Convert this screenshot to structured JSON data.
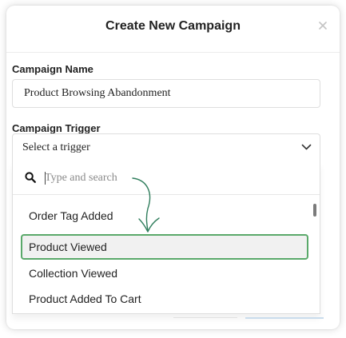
{
  "modal": {
    "title": "Create New Campaign",
    "close_icon": "close-icon"
  },
  "campaign_name": {
    "label": "Campaign Name",
    "value": "Product Browsing Abandonment"
  },
  "campaign_trigger": {
    "label": "Campaign Trigger",
    "selected_text": "Select a trigger",
    "chevron_icon": "chevron-down-icon"
  },
  "dropdown": {
    "search_placeholder": "Type and search",
    "search_icon": "search-icon",
    "options": [
      {
        "label": "Order Tag Added"
      },
      {
        "label": "Product Viewed",
        "highlighted": true
      },
      {
        "label": "Collection Viewed"
      },
      {
        "label": "Product Added To Cart"
      }
    ]
  },
  "colors": {
    "highlight_border": "#5aa96a",
    "annotation_arrow": "#2f7d5c"
  }
}
